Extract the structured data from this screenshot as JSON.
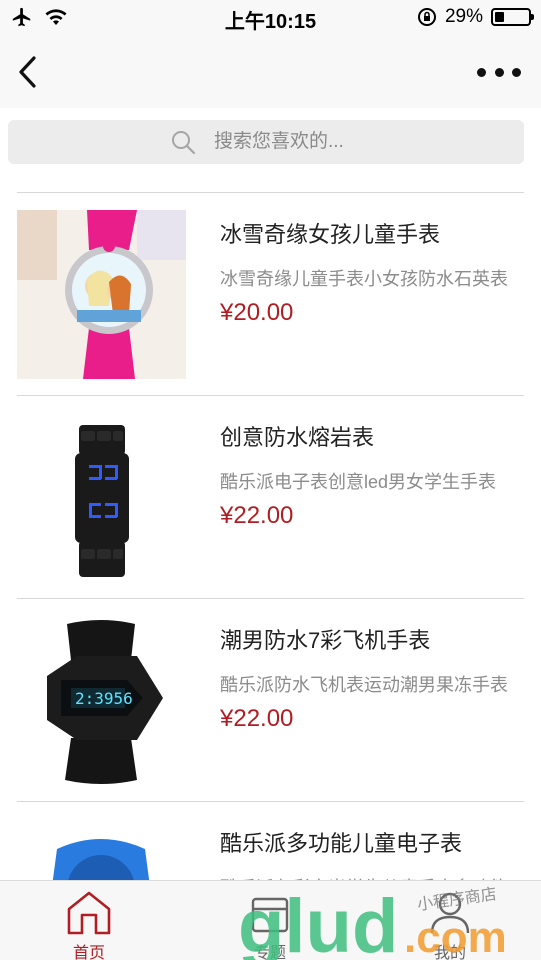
{
  "status_bar": {
    "time": "上午10:15",
    "battery_text": "29%",
    "battery_level": 0.29
  },
  "nav": {
    "back_icon": "chevron-left-icon",
    "more_icon": "more-dots-icon"
  },
  "search": {
    "placeholder": "搜索您喜欢的..."
  },
  "products": [
    {
      "title": "冰雪奇缘女孩儿童手表",
      "desc": "冰雪奇缘儿童手表小女孩防水石英表",
      "price": "¥20.00"
    },
    {
      "title": "创意防水熔岩表",
      "desc": "酷乐派电子表创意led男女学生手表",
      "price": "¥22.00"
    },
    {
      "title": "潮男防水7彩飞机手表",
      "desc": "酷乐派防水飞机表运动潮男果冻手表",
      "price": "¥22.00"
    },
    {
      "title": "酷乐派多功能儿童电子表",
      "desc": "酷乐派七彩夜光学生儿童手表多功能",
      "price": ""
    }
  ],
  "tabs": [
    {
      "label": "首页",
      "icon": "home-icon",
      "active": true
    },
    {
      "label": "专题",
      "icon": "topic-icon",
      "active": false
    },
    {
      "label": "我的",
      "icon": "user-icon",
      "active": false
    }
  ],
  "watermark": {
    "text": "glud.com",
    "subtext": "小程序商店"
  },
  "colors": {
    "accent": "#b01d23",
    "watermark_green": "#3fbf7f",
    "watermark_orange": "#f29b2e"
  }
}
